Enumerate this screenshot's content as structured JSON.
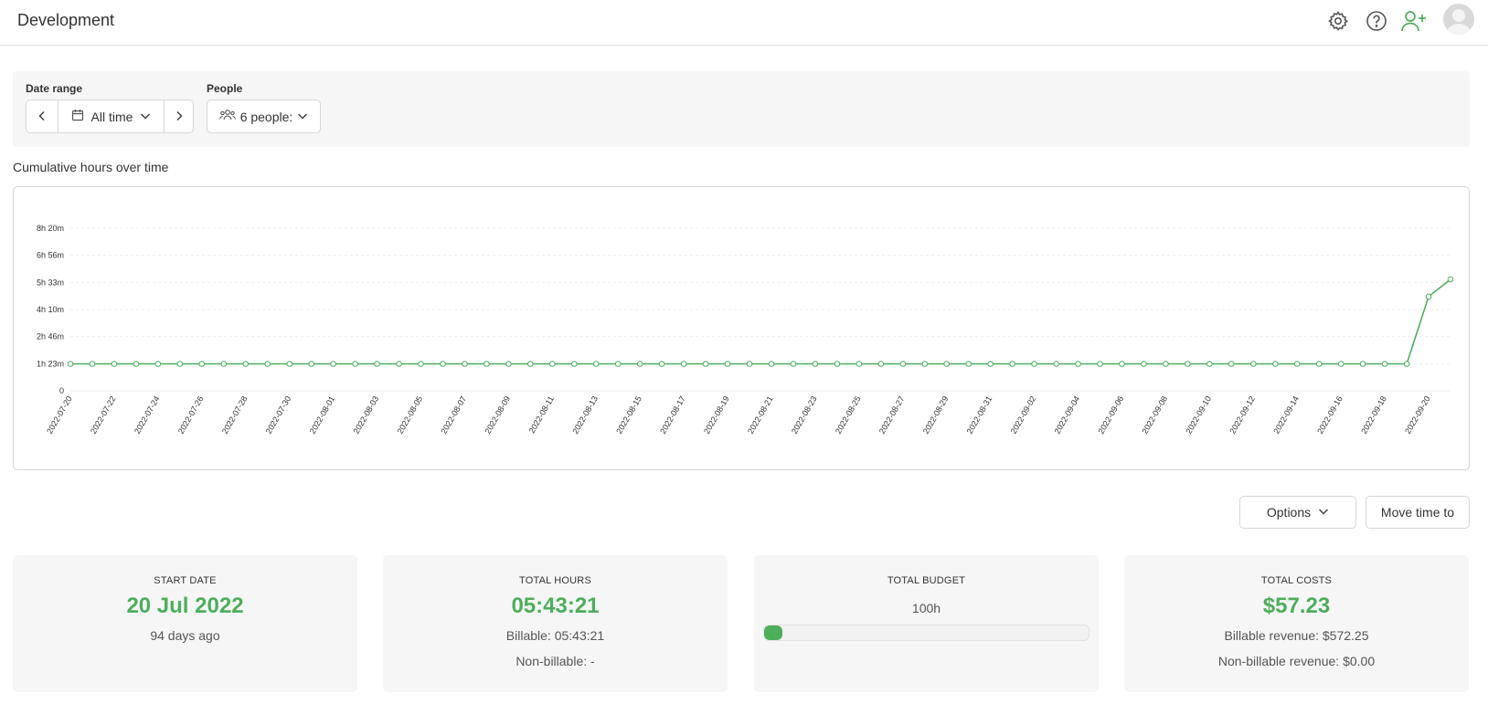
{
  "header": {
    "title": "Development",
    "icons": [
      "gear-icon",
      "help-icon",
      "add-user-icon"
    ],
    "accent_color": "#4caf5a"
  },
  "filters": {
    "date_range_label": "Date range",
    "date_range_value": "All time",
    "people_label": "People",
    "people_value": "6 people:"
  },
  "chart_section": {
    "title": "Cumulative hours over time"
  },
  "chart_data": {
    "type": "line",
    "color": "#4caf5a",
    "y_ticks": [
      "0",
      "1h 23m",
      "2h 46m",
      "4h 10m",
      "5h 33m",
      "6h 56m",
      "8h 20m"
    ],
    "y_tick_minutes": [
      0,
      83.33,
      166.67,
      250,
      333.33,
      416.67,
      500
    ],
    "ylim_minutes": [
      0,
      500
    ],
    "x_tick_labels": [
      "2022-07-20",
      "2022-07-22",
      "2022-07-24",
      "2022-07-26",
      "2022-07-28",
      "2022-07-30",
      "2022-08-01",
      "2022-08-03",
      "2022-08-05",
      "2022-08-07",
      "2022-08-09",
      "2022-08-11",
      "2022-08-13",
      "2022-08-15",
      "2022-08-17",
      "2022-08-19",
      "2022-08-21",
      "2022-08-23",
      "2022-08-25",
      "2022-08-27",
      "2022-08-29",
      "2022-08-31",
      "2022-09-02",
      "2022-09-04",
      "2022-09-06",
      "2022-09-08",
      "2022-09-10",
      "2022-09-12",
      "2022-09-14",
      "2022-09-16",
      "2022-09-18",
      "2022-09-20"
    ],
    "x_start": "2022-07-20",
    "x_end": "2022-09-21",
    "values_minutes": [
      83,
      83,
      83,
      83,
      83,
      83,
      83,
      83,
      83,
      83,
      83,
      83,
      83,
      83,
      83,
      83,
      83,
      83,
      83,
      83,
      83,
      83,
      83,
      83,
      83,
      83,
      83,
      83,
      83,
      83,
      83,
      83,
      83,
      83,
      83,
      83,
      83,
      83,
      83,
      83,
      83,
      83,
      83,
      83,
      83,
      83,
      83,
      83,
      83,
      83,
      83,
      83,
      83,
      83,
      83,
      83,
      83,
      83,
      83,
      83,
      83,
      83,
      290,
      343
    ],
    "grid": true,
    "legend": "none"
  },
  "actions": {
    "options_label": "Options",
    "move_time_label": "Move time to"
  },
  "stats": {
    "start_date": {
      "label": "START DATE",
      "value": "20 Jul 2022",
      "sub": "94 days ago"
    },
    "total_hours": {
      "label": "TOTAL HOURS",
      "value": "05:43:21",
      "billable": "Billable: 05:43:21",
      "non_billable": "Non-billable: -"
    },
    "total_budget": {
      "label": "TOTAL BUDGET",
      "value": "100h",
      "progress_fraction": 0.057
    },
    "total_costs": {
      "label": "TOTAL COSTS",
      "value": "$57.23",
      "billable_revenue": "Billable revenue: $572.25",
      "non_billable_revenue": "Non-billable revenue: $0.00"
    }
  }
}
